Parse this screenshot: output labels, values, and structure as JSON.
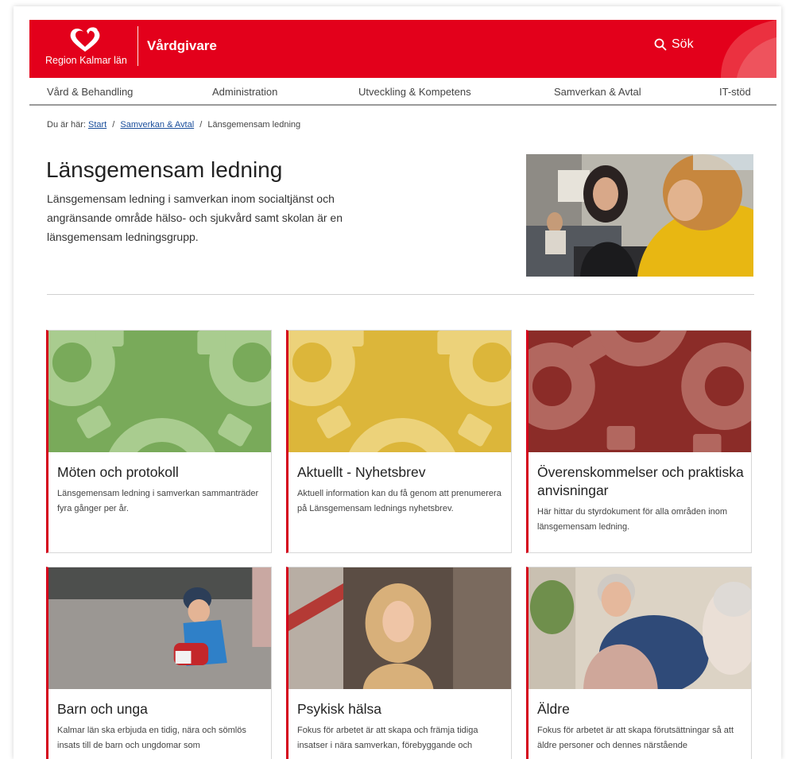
{
  "header": {
    "brand": "Region Kalmar län",
    "site_name": "Vårdgivare",
    "search_label": "Sök",
    "brand_color": "#e3001b"
  },
  "nav": {
    "items": [
      {
        "label": "Vård & Behandling"
      },
      {
        "label": "Administration"
      },
      {
        "label": "Utveckling & Kompetens"
      },
      {
        "label": "Samverkan & Avtal"
      },
      {
        "label": "IT-stöd"
      }
    ]
  },
  "breadcrumb": {
    "prefix": "Du är här:",
    "links": [
      "Start",
      "Samverkan & Avtal"
    ],
    "separator": "/",
    "current": "Länsgemensam ledning"
  },
  "hero": {
    "title": "Länsgemensam ledning",
    "intro": "Länsgemensam ledning i samverkan inom socialtjänst och angränsande område hälso- och sjukvård samt skolan är en länsgemensam ledningsgrupp."
  },
  "cards": [
    {
      "title": "Möten och protokoll",
      "desc": "Länsgemensam ledning i samverkan sammanträder fyra gånger per år.",
      "color": "#79aa5a"
    },
    {
      "title": "Aktuellt - Nyhetsbrev",
      "desc": "Aktuell information kan du få genom att prenumerera på Länsgemensam lednings nyhetsbrev.",
      "color": "#dcb63a"
    },
    {
      "title": "Överenskommelser och praktiska anvisningar",
      "desc": "Här hittar du styrdokument för alla områden inom länsgemensam ledning.",
      "color": "#8b2c28"
    },
    {
      "title": "Barn och unga",
      "desc": "Kalmar län ska erbjuda en tidig, nära och sömlös insats till de barn och ungdomar som"
    },
    {
      "title": "Psykisk hälsa",
      "desc": "Fokus för arbetet är att skapa och främja tidiga insatser i nära samverkan, förebyggande och"
    },
    {
      "title": "Äldre",
      "desc": "Fokus för arbetet är att skapa förutsättningar så att äldre personer och dennes närstående"
    }
  ]
}
